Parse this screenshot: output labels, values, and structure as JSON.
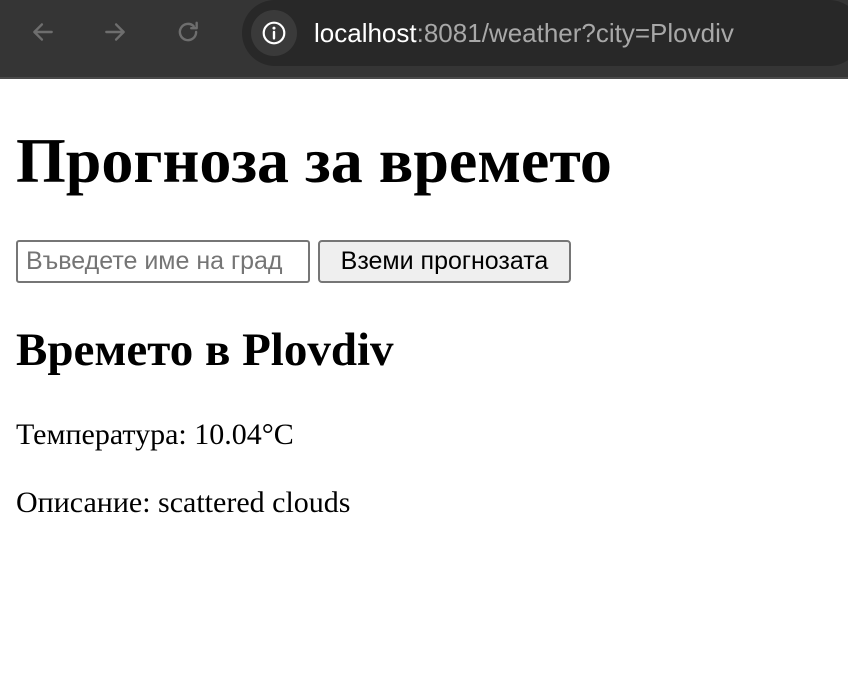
{
  "browser": {
    "url_host": "localhost",
    "url_rest": ":8081/weather?city=Plovdiv",
    "icons": {
      "back": "arrow-left-icon",
      "forward": "arrow-right-icon",
      "reload": "reload-icon",
      "site_info": "info-circle-icon"
    },
    "colors": {
      "toolbar_bg": "#353535",
      "omnibox_bg": "#282828"
    }
  },
  "page": {
    "title": "Прогноза за времето",
    "search": {
      "placeholder": "Въведете име на град",
      "value": "",
      "button_label": "Вземи прогнозата"
    },
    "result": {
      "heading": "Времето в Plovdiv",
      "temperature_line": "Температура: 10.04°C",
      "description_line": "Описание: scattered clouds"
    }
  }
}
